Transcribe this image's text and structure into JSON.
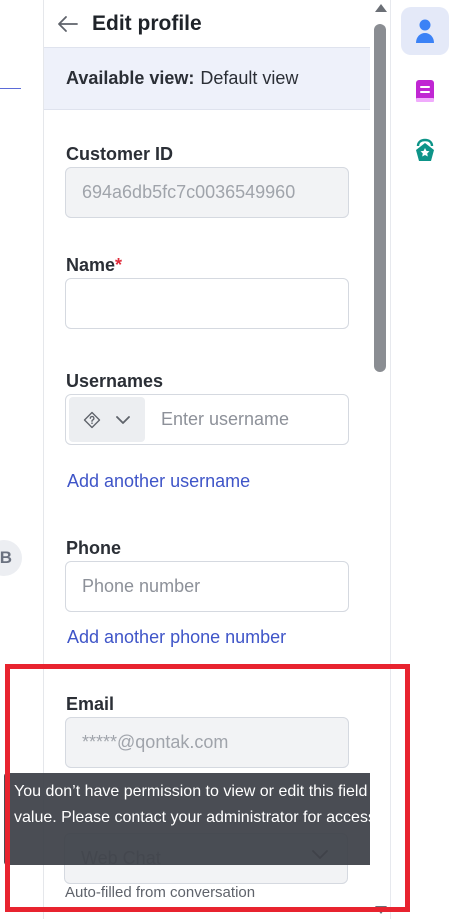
{
  "left": {
    "avatar_letter": "B"
  },
  "header": {
    "title": "Edit profile",
    "back_icon": "arrow-left-icon"
  },
  "view_banner": {
    "label": "Available view:",
    "value": "Default view"
  },
  "fields": {
    "customer_id": {
      "label": "Customer ID",
      "value": "694a6db5fc7c0036549960"
    },
    "name": {
      "label": "Name",
      "required_mark": "*",
      "value": ""
    },
    "usernames": {
      "label": "Usernames",
      "placeholder": "Enter username",
      "add_link": "Add another username"
    },
    "phone": {
      "label": "Phone",
      "placeholder": "Phone number",
      "add_link": "Add another phone number"
    },
    "email": {
      "label": "Email",
      "value": "*****@qontak.com"
    },
    "channel": {
      "value": "Web Chat",
      "hint": "Auto-filled from conversation"
    }
  },
  "tooltip": {
    "text": "You don’t have permission to view or edit this field value. Please contact your administrator for access."
  },
  "rail": {
    "items": [
      {
        "icon": "contact-person-icon",
        "active": true,
        "color": "#3b82f6"
      },
      {
        "icon": "notes-icon",
        "active": false,
        "color": "#c026d3"
      },
      {
        "icon": "ticket-icon",
        "active": false,
        "color": "#0d9488"
      }
    ]
  },
  "colors": {
    "accent_link": "#3f55c8",
    "highlight_outline": "#e8232f",
    "required": "#e02b3a"
  }
}
